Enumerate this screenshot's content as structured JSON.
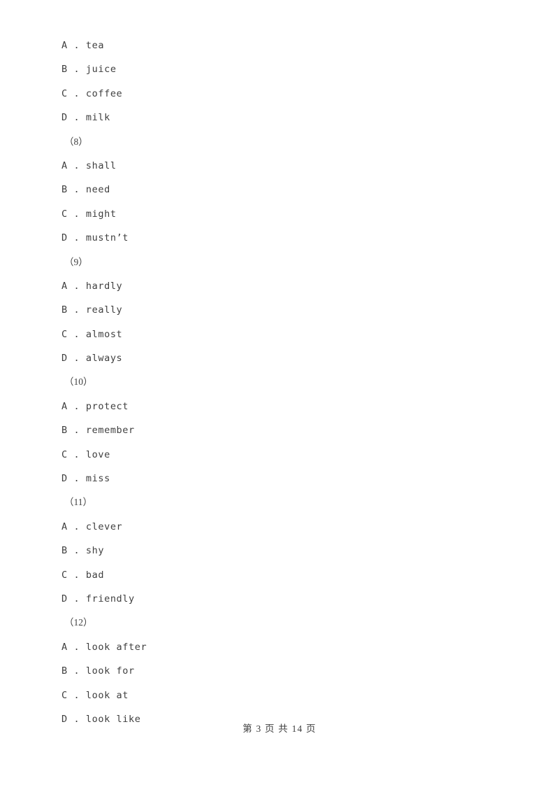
{
  "document": {
    "page_label": "第 3 页 共 14 页",
    "current_page": "3",
    "total_pages": "14",
    "text_color": "#3f3f3f",
    "background_color": "#ffffff"
  },
  "lines": [
    {
      "type": "option",
      "text": "A . tea"
    },
    {
      "type": "option",
      "text": "B . juice"
    },
    {
      "type": "option",
      "text": "C . coffee"
    },
    {
      "type": "option",
      "text": "D . milk"
    },
    {
      "type": "qnum",
      "text": "（8）"
    },
    {
      "type": "option",
      "text": "A . shall"
    },
    {
      "type": "option",
      "text": "B . need"
    },
    {
      "type": "option",
      "text": "C . might"
    },
    {
      "type": "option",
      "text": "D . mustn’t"
    },
    {
      "type": "qnum",
      "text": "（9）"
    },
    {
      "type": "option",
      "text": "A . hardly"
    },
    {
      "type": "option",
      "text": "B . really"
    },
    {
      "type": "option",
      "text": "C . almost"
    },
    {
      "type": "option",
      "text": "D . always"
    },
    {
      "type": "qnum",
      "text": "（10）"
    },
    {
      "type": "option",
      "text": "A . protect"
    },
    {
      "type": "option",
      "text": "B . remember"
    },
    {
      "type": "option",
      "text": "C . love"
    },
    {
      "type": "option",
      "text": "D . miss"
    },
    {
      "type": "qnum",
      "text": "（11）"
    },
    {
      "type": "option",
      "text": "A . clever"
    },
    {
      "type": "option",
      "text": "B . shy"
    },
    {
      "type": "option",
      "text": "C . bad"
    },
    {
      "type": "option",
      "text": "D . friendly"
    },
    {
      "type": "qnum",
      "text": "（12）"
    },
    {
      "type": "option",
      "text": "A . look after"
    },
    {
      "type": "option",
      "text": "B . look for"
    },
    {
      "type": "option",
      "text": "C . look at"
    },
    {
      "type": "option",
      "text": "D . look like"
    }
  ],
  "questions": [
    {
      "number": "（8）",
      "options": [
        "A . shall",
        "B . need",
        "C . might",
        "D . mustn’t"
      ]
    },
    {
      "number": "（9）",
      "options": [
        "A . hardly",
        "B . really",
        "C . almost",
        "D . always"
      ]
    },
    {
      "number": "（10）",
      "options": [
        "A . protect",
        "B . remember",
        "C . love",
        "D . miss"
      ]
    },
    {
      "number": "（11）",
      "options": [
        "A . clever",
        "B . shy",
        "C . bad",
        "D . friendly"
      ]
    },
    {
      "number": "（12）",
      "options": [
        "A . look after",
        "B . look for",
        "C . look at",
        "D . look like"
      ]
    }
  ],
  "orphan_options": [
    "A . tea",
    "B . juice",
    "C . coffee",
    "D . milk"
  ]
}
